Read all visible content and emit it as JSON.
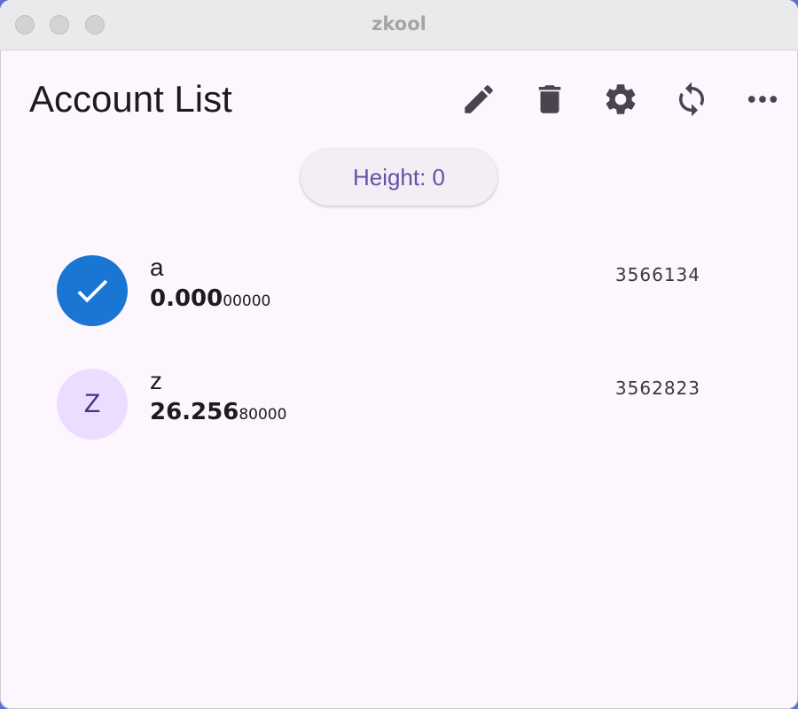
{
  "window": {
    "title": "zkool"
  },
  "header": {
    "title": "Account List",
    "actions": [
      {
        "name": "edit",
        "icon": "pencil-icon"
      },
      {
        "name": "delete",
        "icon": "trash-icon"
      },
      {
        "name": "settings",
        "icon": "gear-icon"
      },
      {
        "name": "sync",
        "icon": "sync-icon"
      },
      {
        "name": "more",
        "icon": "more-horizontal-icon"
      }
    ]
  },
  "height_chip": {
    "label": "Height: 0"
  },
  "accounts": [
    {
      "name": "a",
      "avatar_icon": "check-icon",
      "selected": true,
      "balance_main": "0.000",
      "balance_small": "00000",
      "height": "3566134"
    },
    {
      "name": "z",
      "avatar_letter": "Z",
      "selected": false,
      "balance_main": "26.256",
      "balance_small": "80000",
      "height": "3562823"
    }
  ],
  "colors": {
    "selected_avatar": "#1976d2",
    "avatar_bg": "#eaddff",
    "accent": "#6750a4",
    "background": "#fdf6fe"
  }
}
